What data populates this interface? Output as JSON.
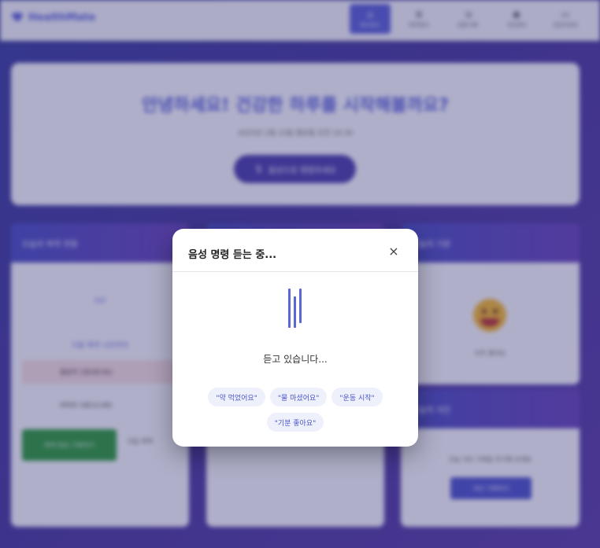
{
  "app": {
    "logo_text": "HealthMate",
    "nav": [
      {
        "label": "대시보드",
        "icon": "home-icon",
        "glyph": "⌂"
      },
      {
        "label": "복약관리",
        "icon": "pill-icon",
        "glyph": "≣"
      },
      {
        "label": "운동기록",
        "icon": "run-icon",
        "glyph": "⇲"
      },
      {
        "label": "식단관리",
        "icon": "food-icon",
        "glyph": "◉"
      },
      {
        "label": "건강리포트",
        "icon": "chart-icon",
        "glyph": "▭"
      }
    ],
    "hero": {
      "title": "안녕하세요! 건강한 하루를 시작해볼까요?",
      "subtitle": "2025년 1월 15일 월요일 오전 10:30",
      "voice_button": "음성으로 명령하세요"
    },
    "cards": {
      "medication": {
        "title": "오늘의 복약 현황",
        "progress_label": "0/2",
        "link": "다음 복약 시간까지",
        "rows": [
          "혈압약 1정(08:00)",
          "비타민 1정(12:00)"
        ],
        "take_button": "복약 완료 기록하기",
        "later_button": "다음 복약"
      },
      "mood": {
        "title": "오늘의 기분",
        "label": "아주 좋아요"
      },
      "meal": {
        "title": "오늘의 식단",
        "text": "오늘 식단 기록을 추가해 보세요",
        "button": "식단 기록하기"
      }
    }
  },
  "modal": {
    "title": "음성 명령 듣는 중...",
    "close_symbol": "×",
    "status": "듣고 있습니다...",
    "suggestions": [
      "\"약 먹었어요\"",
      "\"물 마셨어요\"",
      "\"운동 시작\"",
      "\"기분 좋아요\""
    ]
  },
  "colors": {
    "accent": "#5b68d4",
    "chip_bg": "#eef0fb",
    "overlay": "#28286e"
  }
}
